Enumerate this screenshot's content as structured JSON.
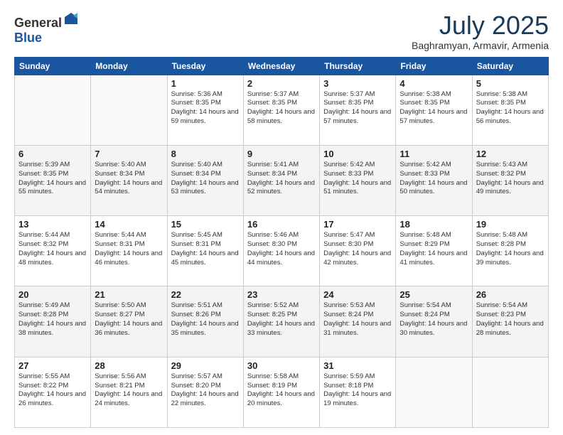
{
  "header": {
    "logo_general": "General",
    "logo_blue": "Blue",
    "month": "July 2025",
    "location": "Baghramyan, Armavir, Armenia"
  },
  "days_of_week": [
    "Sunday",
    "Monday",
    "Tuesday",
    "Wednesday",
    "Thursday",
    "Friday",
    "Saturday"
  ],
  "weeks": [
    [
      {
        "day": "",
        "info": ""
      },
      {
        "day": "",
        "info": ""
      },
      {
        "day": "1",
        "info": "Sunrise: 5:36 AM\nSunset: 8:35 PM\nDaylight: 14 hours and 59 minutes."
      },
      {
        "day": "2",
        "info": "Sunrise: 5:37 AM\nSunset: 8:35 PM\nDaylight: 14 hours and 58 minutes."
      },
      {
        "day": "3",
        "info": "Sunrise: 5:37 AM\nSunset: 8:35 PM\nDaylight: 14 hours and 57 minutes."
      },
      {
        "day": "4",
        "info": "Sunrise: 5:38 AM\nSunset: 8:35 PM\nDaylight: 14 hours and 57 minutes."
      },
      {
        "day": "5",
        "info": "Sunrise: 5:38 AM\nSunset: 8:35 PM\nDaylight: 14 hours and 56 minutes."
      }
    ],
    [
      {
        "day": "6",
        "info": "Sunrise: 5:39 AM\nSunset: 8:35 PM\nDaylight: 14 hours and 55 minutes."
      },
      {
        "day": "7",
        "info": "Sunrise: 5:40 AM\nSunset: 8:34 PM\nDaylight: 14 hours and 54 minutes."
      },
      {
        "day": "8",
        "info": "Sunrise: 5:40 AM\nSunset: 8:34 PM\nDaylight: 14 hours and 53 minutes."
      },
      {
        "day": "9",
        "info": "Sunrise: 5:41 AM\nSunset: 8:34 PM\nDaylight: 14 hours and 52 minutes."
      },
      {
        "day": "10",
        "info": "Sunrise: 5:42 AM\nSunset: 8:33 PM\nDaylight: 14 hours and 51 minutes."
      },
      {
        "day": "11",
        "info": "Sunrise: 5:42 AM\nSunset: 8:33 PM\nDaylight: 14 hours and 50 minutes."
      },
      {
        "day": "12",
        "info": "Sunrise: 5:43 AM\nSunset: 8:32 PM\nDaylight: 14 hours and 49 minutes."
      }
    ],
    [
      {
        "day": "13",
        "info": "Sunrise: 5:44 AM\nSunset: 8:32 PM\nDaylight: 14 hours and 48 minutes."
      },
      {
        "day": "14",
        "info": "Sunrise: 5:44 AM\nSunset: 8:31 PM\nDaylight: 14 hours and 46 minutes."
      },
      {
        "day": "15",
        "info": "Sunrise: 5:45 AM\nSunset: 8:31 PM\nDaylight: 14 hours and 45 minutes."
      },
      {
        "day": "16",
        "info": "Sunrise: 5:46 AM\nSunset: 8:30 PM\nDaylight: 14 hours and 44 minutes."
      },
      {
        "day": "17",
        "info": "Sunrise: 5:47 AM\nSunset: 8:30 PM\nDaylight: 14 hours and 42 minutes."
      },
      {
        "day": "18",
        "info": "Sunrise: 5:48 AM\nSunset: 8:29 PM\nDaylight: 14 hours and 41 minutes."
      },
      {
        "day": "19",
        "info": "Sunrise: 5:48 AM\nSunset: 8:28 PM\nDaylight: 14 hours and 39 minutes."
      }
    ],
    [
      {
        "day": "20",
        "info": "Sunrise: 5:49 AM\nSunset: 8:28 PM\nDaylight: 14 hours and 38 minutes."
      },
      {
        "day": "21",
        "info": "Sunrise: 5:50 AM\nSunset: 8:27 PM\nDaylight: 14 hours and 36 minutes."
      },
      {
        "day": "22",
        "info": "Sunrise: 5:51 AM\nSunset: 8:26 PM\nDaylight: 14 hours and 35 minutes."
      },
      {
        "day": "23",
        "info": "Sunrise: 5:52 AM\nSunset: 8:25 PM\nDaylight: 14 hours and 33 minutes."
      },
      {
        "day": "24",
        "info": "Sunrise: 5:53 AM\nSunset: 8:24 PM\nDaylight: 14 hours and 31 minutes."
      },
      {
        "day": "25",
        "info": "Sunrise: 5:54 AM\nSunset: 8:24 PM\nDaylight: 14 hours and 30 minutes."
      },
      {
        "day": "26",
        "info": "Sunrise: 5:54 AM\nSunset: 8:23 PM\nDaylight: 14 hours and 28 minutes."
      }
    ],
    [
      {
        "day": "27",
        "info": "Sunrise: 5:55 AM\nSunset: 8:22 PM\nDaylight: 14 hours and 26 minutes."
      },
      {
        "day": "28",
        "info": "Sunrise: 5:56 AM\nSunset: 8:21 PM\nDaylight: 14 hours and 24 minutes."
      },
      {
        "day": "29",
        "info": "Sunrise: 5:57 AM\nSunset: 8:20 PM\nDaylight: 14 hours and 22 minutes."
      },
      {
        "day": "30",
        "info": "Sunrise: 5:58 AM\nSunset: 8:19 PM\nDaylight: 14 hours and 20 minutes."
      },
      {
        "day": "31",
        "info": "Sunrise: 5:59 AM\nSunset: 8:18 PM\nDaylight: 14 hours and 19 minutes."
      },
      {
        "day": "",
        "info": ""
      },
      {
        "day": "",
        "info": ""
      }
    ]
  ]
}
